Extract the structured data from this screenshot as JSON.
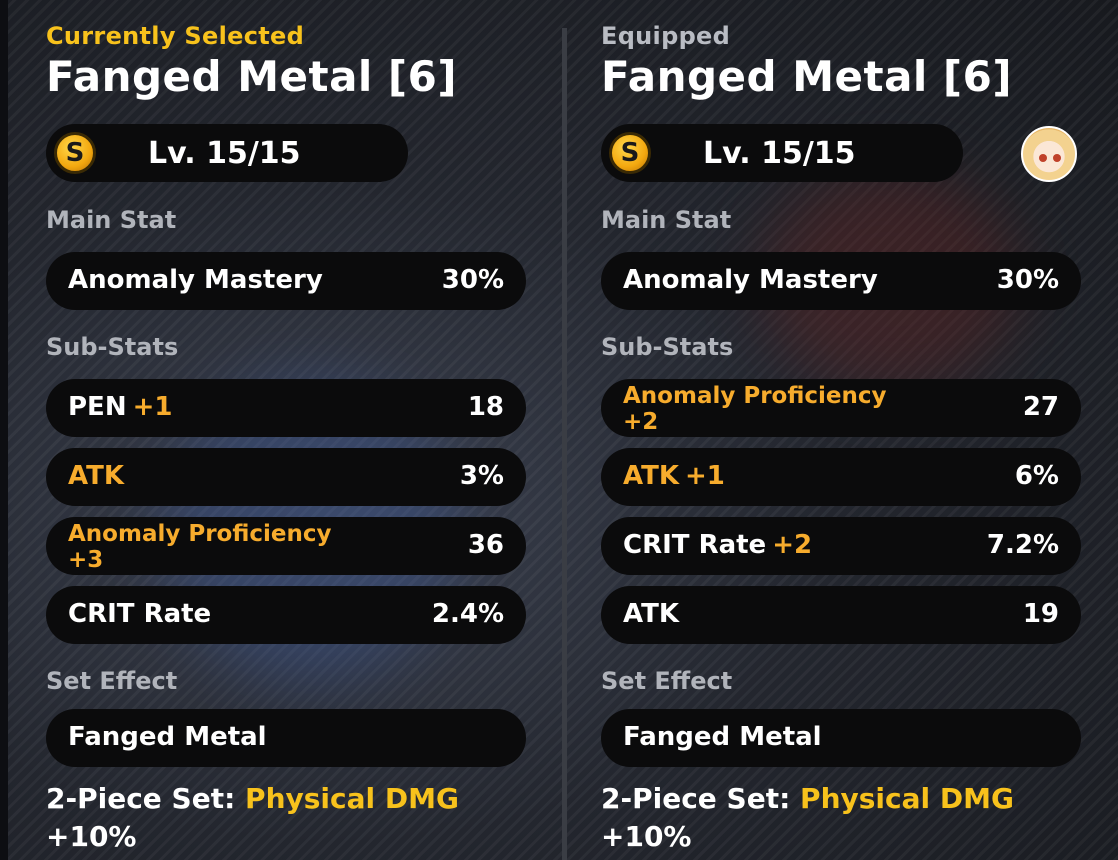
{
  "left": {
    "kicker": "Currently Selected",
    "title": "Fanged Metal [6]",
    "level": "Lv. 15/15",
    "main_stat_header": "Main Stat",
    "main_stat": {
      "name": "Anomaly Mastery",
      "value": "30%"
    },
    "sub_stats_header": "Sub-Stats",
    "sub_stats": [
      {
        "name": "PEN",
        "bonus": "+1",
        "value": "18"
      },
      {
        "name": "ATK",
        "bonus": "",
        "value": "3%"
      },
      {
        "name": "Anomaly Proficiency",
        "bonus": "+3",
        "value": "36"
      },
      {
        "name": "CRIT Rate",
        "bonus": "",
        "value": "2.4%"
      }
    ],
    "set_effect_header": "Set Effect",
    "set_name": "Fanged Metal",
    "set_desc_prefix": "2-Piece Set: ",
    "set_desc_highlight": "Physical DMG",
    "set_desc_suffix": "+10%"
  },
  "right": {
    "kicker": "Equipped",
    "title": "Fanged Metal [6]",
    "level": "Lv. 15/15",
    "main_stat_header": "Main Stat",
    "main_stat": {
      "name": "Anomaly Mastery",
      "value": "30%"
    },
    "sub_stats_header": "Sub-Stats",
    "sub_stats": [
      {
        "name": "Anomaly Proficiency",
        "bonus": "+2",
        "value": "27"
      },
      {
        "name": "ATK",
        "bonus": "+1",
        "value": "6%"
      },
      {
        "name": "CRIT Rate",
        "bonus": "+2",
        "value": "7.2%"
      },
      {
        "name": "ATK",
        "bonus": "",
        "value": "19"
      }
    ],
    "set_effect_header": "Set Effect",
    "set_name": "Fanged Metal",
    "set_desc_prefix": "2-Piece Set: ",
    "set_desc_highlight": "Physical DMG",
    "set_desc_suffix": "+10%"
  },
  "icons": {
    "coin": "S",
    "avatar": "character-avatar-icon"
  },
  "colors": {
    "accent_yellow": "#f8c21c",
    "accent_orange": "#f7ac2d",
    "pill_bg": "#0b0b0c",
    "header_gray": "#b1b4bb"
  }
}
